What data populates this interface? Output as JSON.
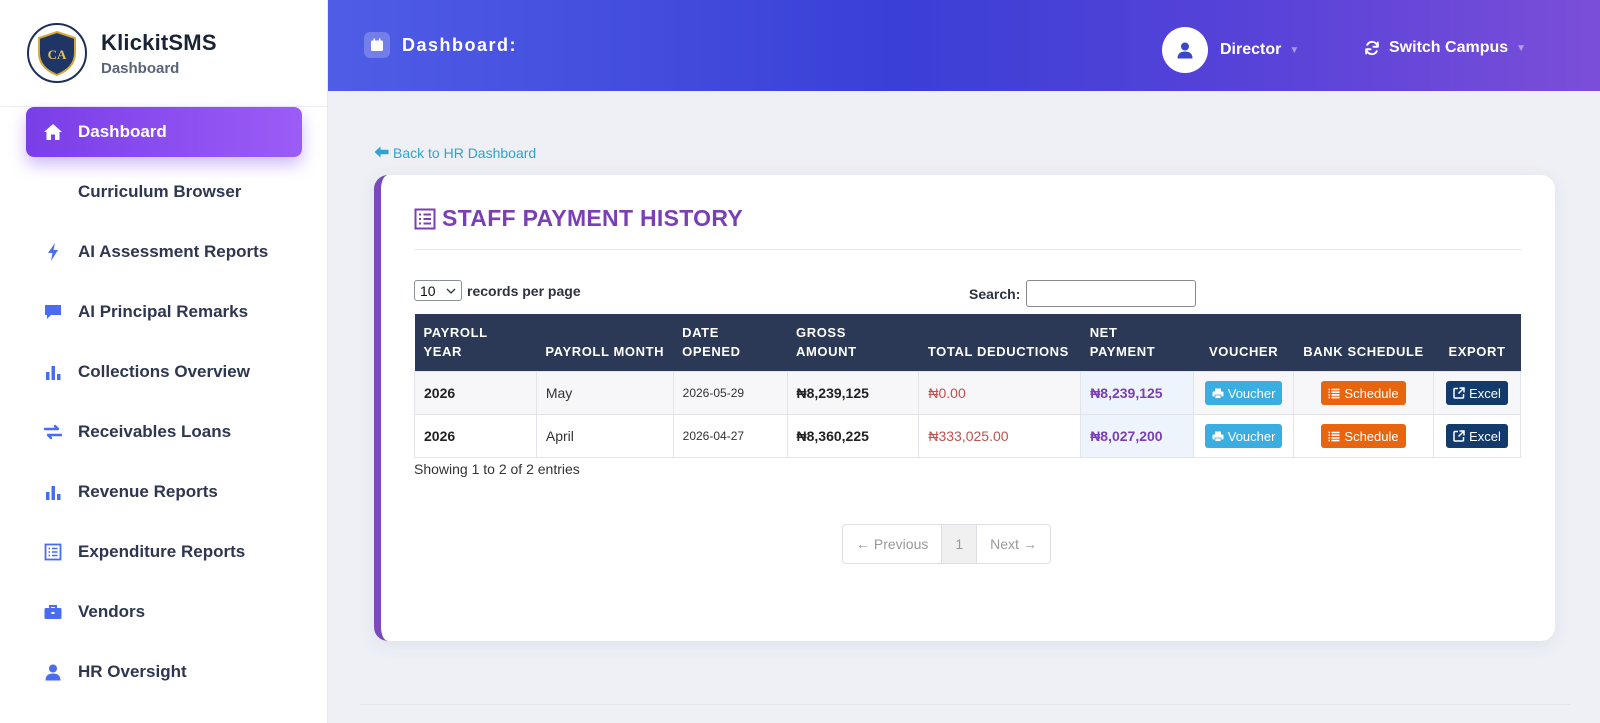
{
  "brand": {
    "logo_text": "CA",
    "name": "KlickitSMS",
    "subtitle": "Dashboard"
  },
  "sidebar": {
    "items": [
      {
        "label": "Dashboard",
        "icon": "home-icon",
        "active": true
      },
      {
        "label": "Curriculum Browser",
        "icon": "",
        "active": false
      },
      {
        "label": "AI Assessment Reports",
        "icon": "bolt-icon",
        "active": false
      },
      {
        "label": "AI Principal Remarks",
        "icon": "comment-icon",
        "active": false
      },
      {
        "label": "Collections Overview",
        "icon": "bar-chart-icon",
        "active": false
      },
      {
        "label": "Receivables Loans",
        "icon": "exchange-icon",
        "active": false
      },
      {
        "label": "Revenue Reports",
        "icon": "bar-chart-icon",
        "active": false
      },
      {
        "label": "Expenditure Reports",
        "icon": "list-icon",
        "active": false
      },
      {
        "label": "Vendors",
        "icon": "briefcase-icon",
        "active": false
      },
      {
        "label": "HR Oversight",
        "icon": "user-icon",
        "active": false
      }
    ]
  },
  "header": {
    "title": "Dashboard:",
    "user_name": "Director",
    "switch_label": "Switch Campus"
  },
  "colors": {
    "accent": "#7a3ee8",
    "header_start": "#4f5de6",
    "header_end": "#7b4ed8",
    "table_header": "#2c3956",
    "title_purple": "#7a3fb5",
    "deduction_red": "#c0504d",
    "voucher_blue": "#3aaee0",
    "schedule_orange": "#e8650f",
    "excel_navy": "#123a6b"
  },
  "main": {
    "back_link": "Back to HR Dashboard",
    "title": "STAFF PAYMENT HISTORY",
    "records_per_page_value": "10",
    "records_per_page_label": "records per page",
    "search_label": "Search:",
    "search_value": "",
    "columns": [
      "PAYROLL YEAR",
      "PAYROLL MONTH",
      "DATE OPENED",
      "GROSS AMOUNT",
      "TOTAL DEDUCTIONS",
      "NET PAYMENT",
      "VOUCHER",
      "BANK SCHEDULE",
      "EXPORT"
    ],
    "rows": [
      {
        "year": "2026",
        "month": "May",
        "date": "2026-05-29",
        "gross": "₦8,239,125",
        "deductions": "₦0.00",
        "net": "₦8,239,125",
        "voucher": "Voucher",
        "schedule": "Schedule",
        "export": "Excel"
      },
      {
        "year": "2026",
        "month": "April",
        "date": "2026-04-27",
        "gross": "₦8,360,225",
        "deductions": "₦333,025.00",
        "net": "₦8,027,200",
        "voucher": "Voucher",
        "schedule": "Schedule",
        "export": "Excel"
      }
    ],
    "showing_text": "Showing 1 to 2 of 2 entries",
    "pagination": {
      "previous": "← Previous",
      "current": "1",
      "next": "Next →"
    }
  }
}
